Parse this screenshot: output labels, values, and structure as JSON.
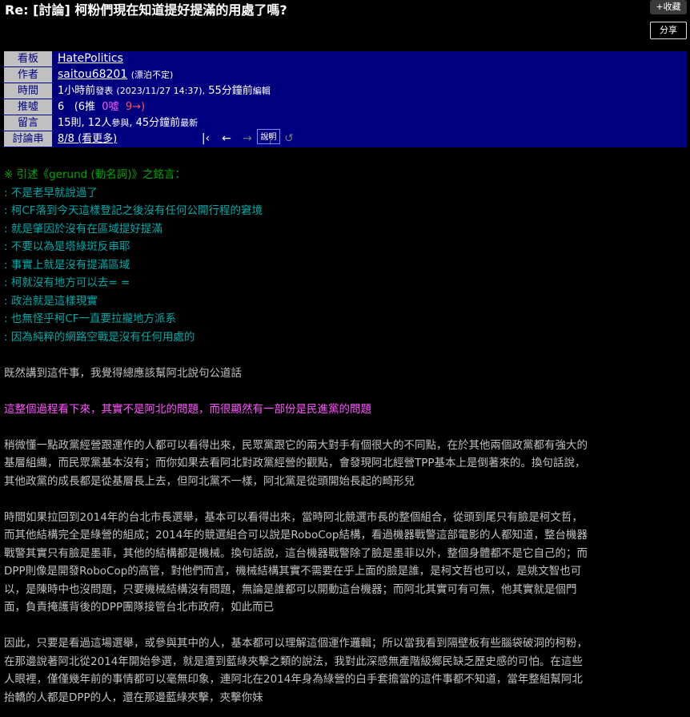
{
  "header": {
    "title": "Re: [討論] 柯粉們現在知道提好提滿的用處了嗎?",
    "collect_label": "+收藏",
    "share_label": "分享"
  },
  "meta": {
    "labels": [
      "看板",
      "作者",
      "時間",
      "推噓",
      "留言",
      "討論串"
    ],
    "board": "HatePolitics",
    "author": "saitou68201",
    "author_nick": "(漂泊不定)",
    "time_rel": "1小時前",
    "time_posted_word": "發表",
    "time_abs": "(2023/11/27 14:37),",
    "time_edit": "55分鐘前",
    "time_edit_word": "編輯",
    "push_score": "6",
    "push_open": "(6推",
    "push_boo": "0噓",
    "push_arrow": "9→)",
    "comments_main": "15則, 12人",
    "comments_participate": "參與",
    "comments_latest_time": ", 45分鐘前",
    "comments_latest_word": "最新",
    "thread_pos": "8/8",
    "thread_view": "(看更多)",
    "help_label": "說明",
    "nav_icons": [
      "first-icon",
      "prev-icon",
      "next-icon",
      "last-icon",
      "refresh-icon"
    ]
  },
  "content": {
    "quote_header": "※ 引述《gerund (動名詞)》之銘言：",
    "quote_lines": [
      ": 不是老早就說過了",
      ": 柯CF落到今天這樣登記之後沒有任何公開行程的窘境",
      ": 就是肇因於沒有在區域提好提滿",
      ": 不要以為是塔綠斑反串耶",
      ": 事實上就是沒有提滿區域",
      ": 柯就沒有地方可以去= =",
      ": 政治就是這樣現實",
      ": 也無怪乎柯CF一直要拉攏地方派系",
      ": 因為純粹的網路空戰是沒有任何用處的"
    ],
    "para1": "既然講到這件事，我覺得總應該幫阿北說句公道話",
    "highlight": "這整個過程看下來，其實不是阿北的問題，而很顯然有一部份是民進黨的問題",
    "para2": [
      "稍微懂一點政黨經營跟運作的人都可以看得出來，民眾黨跟它的兩大對手有個很大的不同點，在於其他兩個政黨都有強大的",
      "基層組織，而民眾黨基本沒有；而你如果去看阿北對政黨經營的觀點，會發現阿北經營TPP基本上是倒著來的。換句話說，",
      "其他政黨的成長都是從基層長上去，但阿北黨不一樣，阿北黨是從頭開始長起的畸形兒"
    ],
    "para3": [
      "時間如果拉回到2014年的台北市長選舉，基本可以看得出來，當時阿北競選市長的整個組合，從頭到尾只有臉是柯文哲，",
      "而其他結構完全是綠營的組成；2014年的競選組合可以說是RoboCop結構，看過機器戰警這部電影的人都知道，整台機器",
      "戰警其實只有臉是墨菲，其他的結構都是機械。換句話說，這台機器戰警除了臉是墨菲以外，整個身體都不是它自己的；而",
      "DPP則像是開發RoboCop的高管，對他們而言，機械結構其實不需要在乎上面的臉是誰，是柯文哲也可以，是姚文智也可",
      "以，是陳時中也沒問題，只要機械結構沒有問題，無論是誰都可以開動這台機器；而阿北其實可有可無，他其實就是個門",
      "面，負責掩護背後的DPP團隊接管台北市政府，如此而已"
    ],
    "para4": [
      "因此，只要是看過這場選舉，或參與其中的人，基本都可以理解這個運作邏輯；所以當我看到隔壁板有些腦袋破洞的柯粉，",
      "在那邊說著阿北從2014年開始參選，就是遭到藍綠夾擊之類的說法，我對此深感無產階級鄉民缺乏歷史感的可怕。在這些",
      "人眼裡，僅僅幾年前的事情都可以毫無印象，連阿北在2014年身為綠營的白手套擔當的這件事都不知道，當年整組幫阿北",
      "抬轎的人都是DPP的人，還在那邊藍綠夾擊，夾擊你妹"
    ]
  }
}
